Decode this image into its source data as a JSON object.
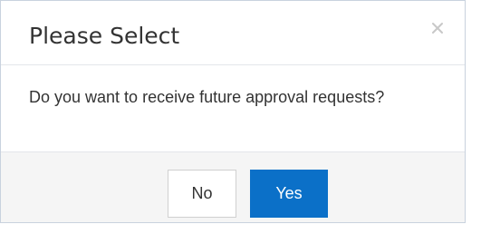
{
  "dialog": {
    "title": "Please Select",
    "message": "Do you want to receive future approval requests?",
    "close_icon": "close-icon",
    "buttons": {
      "no": "No",
      "yes": "Yes"
    },
    "colors": {
      "accent": "#0b70c8",
      "footer_background": "#f5f5f5",
      "text": "#333333"
    }
  }
}
